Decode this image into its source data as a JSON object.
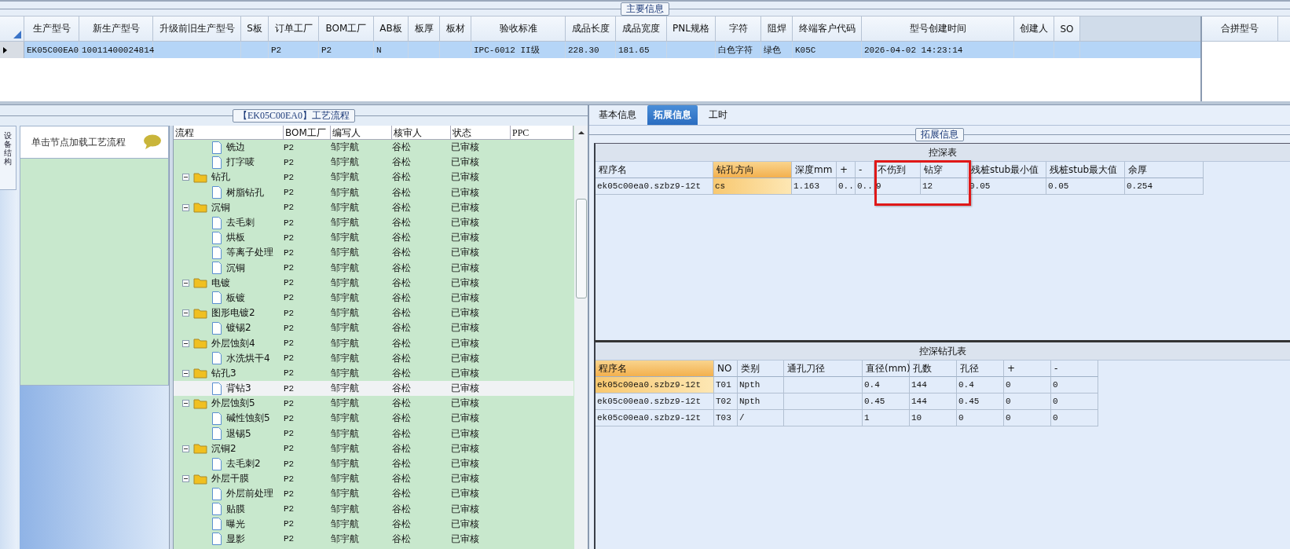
{
  "main_info": {
    "title": "主要信息",
    "columns": [
      "生产型号",
      "新生产型号",
      "升级前旧生产型号",
      "S板",
      "订单工厂",
      "BOM工厂",
      "AB板",
      "板厚",
      "板材",
      "验收标准",
      "成品长度",
      "成品宽度",
      "PNL规格",
      "字符",
      "阻焊",
      "终端客户代码",
      "型号创建时间",
      "创建人",
      "SO"
    ],
    "rows": [
      {
        "selected": true,
        "cells": [
          "EK05C00EA0",
          "10011400024814",
          null,
          null,
          "P2",
          "P2",
          "N",
          null,
          null,
          "IPC-6012 II级",
          "228.30",
          "181.65",
          null,
          "白色字符",
          "绿色",
          "K05C",
          "2026-04-02 14:23:14",
          null,
          null
        ]
      }
    ],
    "side_column": "合拼型号"
  },
  "process": {
    "title": "【EK05C00EA0】工艺流程",
    "side_tab": "设备结构",
    "hint": "单击节点加载工艺流程",
    "columns": [
      "流程",
      "BOM工厂",
      "编写人",
      "核审人",
      "状态",
      "PPC"
    ],
    "tree": [
      {
        "children": [
          {
            "name": "铣边",
            "bom": "P2",
            "writer": "邹宇航",
            "reviewer": "谷松",
            "status": "已审核",
            "selected": false
          },
          {
            "name": "打字唛",
            "bom": "P2",
            "writer": "邹宇航",
            "reviewer": "谷松",
            "status": "已审核",
            "selected": false
          }
        ]
      },
      {
        "name": "钻孔",
        "bom": "P2",
        "writer": "邹宇航",
        "reviewer": "谷松",
        "status": "已审核",
        "selected": false,
        "expanded": true,
        "children": [
          {
            "name": "树脂钻孔",
            "bom": "P2",
            "writer": "邹宇航",
            "reviewer": "谷松",
            "status": "已审核",
            "selected": false
          }
        ]
      },
      {
        "name": "沉铜",
        "bom": "P2",
        "writer": "邹宇航",
        "reviewer": "谷松",
        "status": "已审核",
        "selected": false,
        "expanded": true,
        "children": [
          {
            "name": "去毛刺",
            "bom": "P2",
            "writer": "邹宇航",
            "reviewer": "谷松",
            "status": "已审核",
            "selected": false
          },
          {
            "name": "烘板",
            "bom": "P2",
            "writer": "邹宇航",
            "reviewer": "谷松",
            "status": "已审核",
            "selected": false
          },
          {
            "name": "等离子处理",
            "bom": "P2",
            "writer": "邹宇航",
            "reviewer": "谷松",
            "status": "已审核",
            "selected": false
          },
          {
            "name": "沉铜",
            "bom": "P2",
            "writer": "邹宇航",
            "reviewer": "谷松",
            "status": "已审核",
            "selected": false
          }
        ]
      },
      {
        "name": "电镀",
        "bom": "P2",
        "writer": "邹宇航",
        "reviewer": "谷松",
        "status": "已审核",
        "selected": false,
        "expanded": true,
        "children": [
          {
            "name": "板镀",
            "bom": "P2",
            "writer": "邹宇航",
            "reviewer": "谷松",
            "status": "已审核",
            "selected": false
          }
        ]
      },
      {
        "name": "图形电镀2",
        "bom": "P2",
        "writer": "邹宇航",
        "reviewer": "谷松",
        "status": "已审核",
        "selected": false,
        "expanded": true,
        "children": [
          {
            "name": "镀锡2",
            "bom": "P2",
            "writer": "邹宇航",
            "reviewer": "谷松",
            "status": "已审核",
            "selected": false
          }
        ]
      },
      {
        "name": "外层蚀刻4",
        "bom": "P2",
        "writer": "邹宇航",
        "reviewer": "谷松",
        "status": "已审核",
        "selected": false,
        "expanded": true,
        "children": [
          {
            "name": "水洗烘干4",
            "bom": "P2",
            "writer": "邹宇航",
            "reviewer": "谷松",
            "status": "已审核",
            "selected": false
          }
        ]
      },
      {
        "name": "钻孔3",
        "bom": "P2",
        "writer": "邹宇航",
        "reviewer": "谷松",
        "status": "已审核",
        "selected": false,
        "expanded": true,
        "children": [
          {
            "name": "背钻3",
            "bom": "P2",
            "writer": "邹宇航",
            "reviewer": "谷松",
            "status": "已审核",
            "selected": true
          }
        ]
      },
      {
        "name": "外层蚀刻5",
        "bom": "P2",
        "writer": "邹宇航",
        "reviewer": "谷松",
        "status": "已审核",
        "selected": false,
        "expanded": true,
        "children": [
          {
            "name": "碱性蚀刻5",
            "bom": "P2",
            "writer": "邹宇航",
            "reviewer": "谷松",
            "status": "已审核",
            "selected": false
          },
          {
            "name": "退锡5",
            "bom": "P2",
            "writer": "邹宇航",
            "reviewer": "谷松",
            "status": "已审核",
            "selected": false
          }
        ]
      },
      {
        "name": "沉铜2",
        "bom": "P2",
        "writer": "邹宇航",
        "reviewer": "谷松",
        "status": "已审核",
        "selected": false,
        "expanded": true,
        "children": [
          {
            "name": "去毛刺2",
            "bom": "P2",
            "writer": "邹宇航",
            "reviewer": "谷松",
            "status": "已审核",
            "selected": false
          }
        ]
      },
      {
        "name": "外层干膜",
        "bom": "P2",
        "writer": "邹宇航",
        "reviewer": "谷松",
        "status": "已审核",
        "selected": false,
        "expanded": true,
        "children": [
          {
            "name": "外层前处理",
            "bom": "P2",
            "writer": "邹宇航",
            "reviewer": "谷松",
            "status": "已审核",
            "selected": false
          },
          {
            "name": "贴膜",
            "bom": "P2",
            "writer": "邹宇航",
            "reviewer": "谷松",
            "status": "已审核",
            "selected": false
          },
          {
            "name": "曝光",
            "bom": "P2",
            "writer": "邹宇航",
            "reviewer": "谷松",
            "status": "已审核",
            "selected": false
          },
          {
            "name": "显影",
            "bom": "P2",
            "writer": "邹宇航",
            "reviewer": "谷松",
            "status": "已审核",
            "selected": false
          }
        ]
      }
    ]
  },
  "detail": {
    "tabs": [
      {
        "label": "基本信息",
        "selected": false
      },
      {
        "label": "拓展信息",
        "selected": true
      },
      {
        "label": "工时",
        "selected": false
      }
    ],
    "group_title": "拓展信息",
    "depth_table": {
      "title": "控深表",
      "columns": [
        {
          "label": "程序名",
          "selected": false,
          "highlighted": false
        },
        {
          "label": "钻孔方向",
          "selected": true,
          "highlighted": false
        },
        {
          "label": "深度mm",
          "selected": false,
          "highlighted": false
        },
        {
          "label": "+",
          "selected": false,
          "highlighted": false
        },
        {
          "label": "-",
          "selected": false,
          "highlighted": false
        },
        {
          "label": "不伤到",
          "selected": false,
          "highlighted": true
        },
        {
          "label": "钻穿",
          "selected": false,
          "highlighted": true
        },
        {
          "label": "残桩stub最小值",
          "selected": false,
          "highlighted": false
        },
        {
          "label": "残桩stub最大值",
          "selected": false,
          "highlighted": false
        },
        {
          "label": "余厚",
          "selected": false,
          "highlighted": false
        }
      ],
      "rows": [
        {
          "selected": true,
          "cells": [
            "ek05c00ea0.szbz9-12t",
            "cs",
            "1.163",
            "0..",
            "0..",
            "9",
            "12",
            "0.05",
            "0.05",
            "0.254"
          ]
        }
      ]
    },
    "hole_table": {
      "title": "控深钻孔表",
      "columns": [
        {
          "label": "程序名",
          "selected": true,
          "highlighted": false
        },
        {
          "label": "NO",
          "selected": false,
          "highlighted": false
        },
        {
          "label": "类别",
          "selected": false,
          "highlighted": false
        },
        {
          "label": "通孔刀径",
          "selected": false,
          "highlighted": false
        },
        {
          "label": "直径(mm)",
          "selected": false,
          "highlighted": false
        },
        {
          "label": "孔数",
          "selected": false,
          "highlighted": false
        },
        {
          "label": "孔径",
          "selected": false,
          "highlighted": false
        },
        {
          "label": "+",
          "selected": false,
          "highlighted": false
        },
        {
          "label": "-",
          "selected": false,
          "highlighted": false
        }
      ],
      "rows": [
        {
          "selected": true,
          "cells": [
            "ek05c00ea0.szbz9-12t",
            "T01",
            "Npth",
            null,
            "0.4",
            "144",
            "0.4",
            "0",
            "0"
          ]
        },
        {
          "selected": false,
          "cells": [
            "ek05c00ea0.szbz9-12t",
            "T02",
            "Npth",
            null,
            "0.45",
            "144",
            "0.45",
            "0",
            "0"
          ]
        },
        {
          "selected": false,
          "cells": [
            "ek05c00ea0.szbz9-12t",
            "T03",
            "/",
            null,
            "1",
            "10",
            "0",
            "0",
            "0"
          ]
        }
      ]
    }
  }
}
